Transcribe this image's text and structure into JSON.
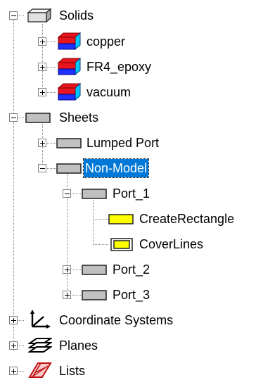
{
  "colors": {
    "selection": "#0078d7",
    "sheet_icon": "#c0c0c0",
    "solid_red": "#e8141e",
    "solid_blue": "#2030ff",
    "solid_cyan": "#00c8ff",
    "rect_yellow": "#ffff00"
  },
  "tree": {
    "solids": {
      "label": "Solids",
      "icon": "solid-box-icon",
      "expanded": true,
      "children": [
        {
          "label": "copper",
          "icon": "material-solid-icon"
        },
        {
          "label": "FR4_epoxy",
          "icon": "material-solid-icon"
        },
        {
          "label": "vacuum",
          "icon": "material-solid-icon"
        }
      ]
    },
    "sheets": {
      "label": "Sheets",
      "icon": "sheet-icon",
      "expanded": true,
      "lumped_port": {
        "label": "Lumped Port"
      },
      "non_model": {
        "label": "Non-Model",
        "selected": true,
        "port_1": {
          "label": "Port_1",
          "create_rectangle": {
            "label": "CreateRectangle",
            "icon": "yellow-rectangle-icon"
          },
          "cover_lines": {
            "label": "CoverLines",
            "icon": "cover-lines-icon"
          }
        },
        "port_2": {
          "label": "Port_2"
        },
        "port_3": {
          "label": "Port_3"
        }
      }
    },
    "coordinate_systems": {
      "label": "Coordinate Systems",
      "icon": "axes-icon"
    },
    "planes": {
      "label": "Planes",
      "icon": "planes-icon"
    },
    "lists": {
      "label": "Lists",
      "icon": "lists-icon"
    }
  }
}
